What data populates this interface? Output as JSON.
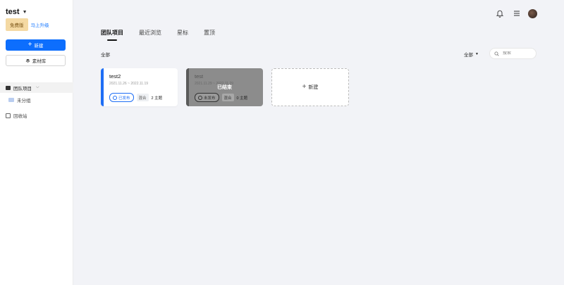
{
  "workspace": {
    "name": "test"
  },
  "plan": {
    "badge": "免费版",
    "upgrade": "马上升级"
  },
  "sidebar": {
    "new_button": "新建",
    "library_button": "素材库",
    "team": "团队项目",
    "uncategorized": "未分组",
    "trash": "回收站"
  },
  "tabs": [
    {
      "label": "团队项目",
      "active": true
    },
    {
      "label": "最近浏览",
      "active": false
    },
    {
      "label": "星标",
      "active": false
    },
    {
      "label": "置顶",
      "active": false
    }
  ],
  "section": {
    "label": "全部"
  },
  "filter": {
    "label": "全部"
  },
  "search": {
    "placeholder": "搜索"
  },
  "cards": [
    {
      "title": "test2",
      "date": "2021.11.26 ~ 2022.11.19",
      "status": "已发布",
      "type": "混合",
      "topics": "2 主题"
    },
    {
      "title": "test",
      "date": "2021.11.29 ~ 2022.11.29",
      "status": "未发布",
      "type": "混合",
      "topics": "0 主题",
      "overlay": "已结束"
    }
  ],
  "add_card": {
    "label": "新建"
  },
  "colors": {
    "primary": "#1e6ef5",
    "sidebar_bg": "#ffffff",
    "main_bg": "#f2f3f7",
    "badge_bg": "#f4d9a3"
  },
  "icons": {
    "bell": "bell-icon",
    "menu": "menu-icon",
    "search": "search-icon"
  }
}
